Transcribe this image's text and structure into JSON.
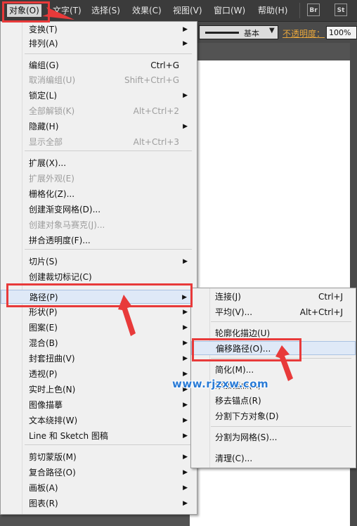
{
  "menubar": {
    "items": [
      "对象(O)",
      "文字(T)",
      "选择(S)",
      "效果(C)",
      "视图(V)",
      "窗口(W)",
      "帮助(H)"
    ],
    "br_label": "Br",
    "st_label": "St"
  },
  "controlbar": {
    "stroke_style": "基本",
    "opacity_label": "不透明度：",
    "opacity_value": "100%"
  },
  "object_menu": {
    "items": [
      {
        "label": "变换(T)",
        "submenu": true
      },
      {
        "label": "排列(A)",
        "submenu": true
      },
      {
        "label": "编组(G)",
        "shortcut": "Ctrl+G"
      },
      {
        "label": "取消编组(U)",
        "shortcut": "Shift+Ctrl+G",
        "disabled": true
      },
      {
        "label": "锁定(L)",
        "submenu": true
      },
      {
        "label": "全部解锁(K)",
        "shortcut": "Alt+Ctrl+2",
        "disabled": true
      },
      {
        "label": "隐藏(H)",
        "submenu": true
      },
      {
        "label": "显示全部",
        "shortcut": "Alt+Ctrl+3",
        "disabled": true
      },
      {
        "label": "扩展(X)..."
      },
      {
        "label": "扩展外观(E)",
        "disabled": true
      },
      {
        "label": "栅格化(Z)..."
      },
      {
        "label": "创建渐变网格(D)..."
      },
      {
        "label": "创建对象马赛克(J)...",
        "disabled": true
      },
      {
        "label": "拼合透明度(F)..."
      },
      {
        "label": "切片(S)",
        "submenu": true
      },
      {
        "label": "创建裁切标记(C)"
      },
      {
        "label": "路径(P)",
        "submenu": true,
        "highlighted": true
      },
      {
        "label": "形状(P)",
        "submenu": true
      },
      {
        "label": "图案(E)",
        "submenu": true
      },
      {
        "label": "混合(B)",
        "submenu": true
      },
      {
        "label": "封套扭曲(V)",
        "submenu": true
      },
      {
        "label": "透视(P)",
        "submenu": true
      },
      {
        "label": "实时上色(N)",
        "submenu": true
      },
      {
        "label": "图像描摹",
        "submenu": true
      },
      {
        "label": "文本绕排(W)",
        "submenu": true
      },
      {
        "label": "Line 和 Sketch 图稿",
        "submenu": true
      },
      {
        "label": "剪切蒙版(M)",
        "submenu": true
      },
      {
        "label": "复合路径(O)",
        "submenu": true
      },
      {
        "label": "画板(A)",
        "submenu": true
      },
      {
        "label": "图表(R)",
        "submenu": true
      }
    ]
  },
  "path_submenu": {
    "items": [
      {
        "label": "连接(J)",
        "shortcut": "Ctrl+J"
      },
      {
        "label": "平均(V)...",
        "shortcut": "Alt+Ctrl+J"
      },
      {
        "label": "轮廓化描边(U)"
      },
      {
        "label": "偏移路径(O)...",
        "highlighted": true
      },
      {
        "label": "简化(M)..."
      },
      {
        "label": "添加锚点(A)"
      },
      {
        "label": "移去锚点(R)"
      },
      {
        "label": "分割下方对象(D)"
      },
      {
        "label": "分割为网格(S)..."
      },
      {
        "label": "清理(C)..."
      }
    ]
  },
  "watermark": "www.rjzxw.com",
  "colors": {
    "annotation_red": "#e83a3a",
    "menu_bg": "#f0f0f0",
    "highlight_bg": "#dfe9f7",
    "watermark_blue": "#2a7bd6",
    "opacity_label": "#e8a73c"
  },
  "icons": {
    "submenu_arrow": "triangle-right",
    "stroke_dropdown": "triangle-down"
  }
}
